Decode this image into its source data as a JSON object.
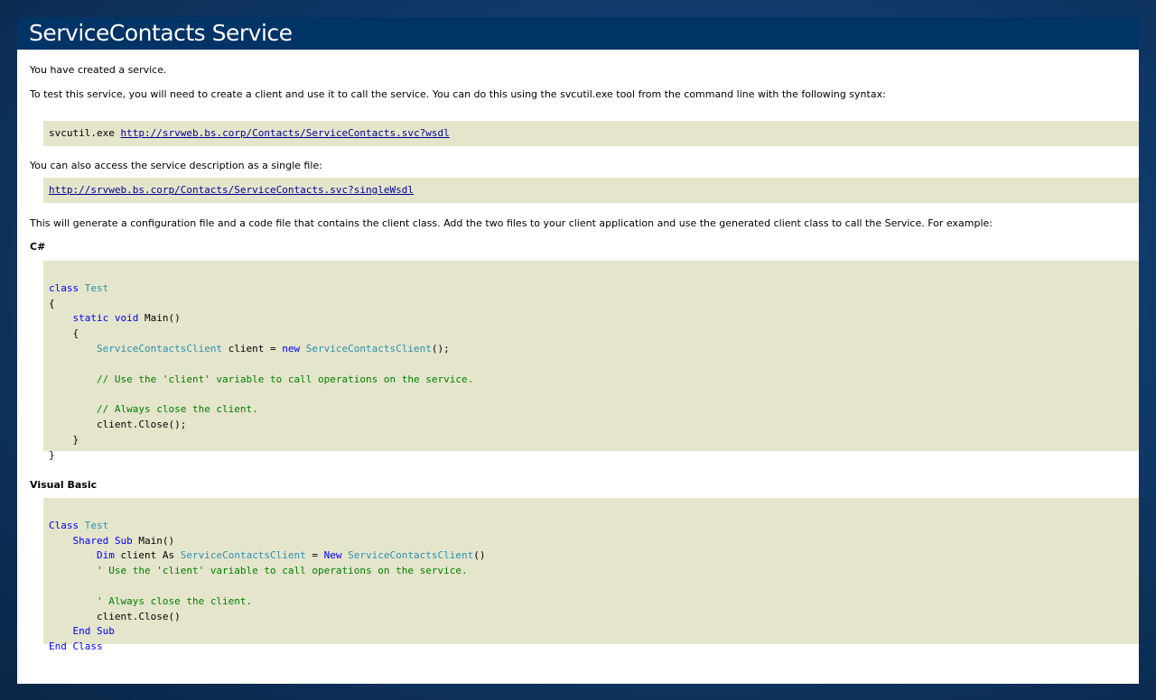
{
  "title": "ServiceContacts Service",
  "intro_line1": "You have created a service.",
  "intro_line2": "To test this service, you will need to create a client and use it to call the service. You can do this using the svcutil.exe tool from the command line with the following syntax:",
  "svcutil_cmd": "svcutil.exe ",
  "wsdl_url": "http://srvweb.bs.corp/Contacts/ServiceContacts.svc?wsdl",
  "single_file_text": "You can also access the service description as a single file:",
  "single_wsdl_url": "http://srvweb.bs.corp/Contacts/ServiceContacts.svc?singleWsdl",
  "generate_text": "This will generate a configuration file and a code file that contains the client class. Add the two files to your client application and use the generated client class to call the Service. For example:",
  "csharp_label": "C#",
  "vb_label": "Visual Basic",
  "csharp_code": {
    "class_kw": "class",
    "class_name": "Test",
    "static_kw": "static",
    "void_kw": "void",
    "main_sig": "Main()",
    "client_type": "ServiceContactsClient",
    "client_decl": " client = ",
    "new_kw": "new",
    "ctor_call": "ServiceContactsClient",
    "ctor_end": "();",
    "comment1": "// Use the 'client' variable to call operations on the service.",
    "comment2": "// Always close the client.",
    "close_call": "client.Close();"
  },
  "vb_code": {
    "class_kw": "Class",
    "class_name": "Test",
    "shared_kw": "Shared",
    "sub_kw": "Sub",
    "main_sig": "Main()",
    "dim_kw": "Dim",
    "dim_rest": " client As ",
    "client_type": "ServiceContactsClient",
    "eq": " = ",
    "new_kw": "New",
    "ctor_call": "ServiceContactsClient",
    "ctor_end": "()",
    "comment1": "' Use the 'client' variable to call operations on the service.",
    "comment2": "' Always close the client.",
    "close_call": "client.Close()",
    "end_sub": "End Sub",
    "end_class": "End Class"
  }
}
